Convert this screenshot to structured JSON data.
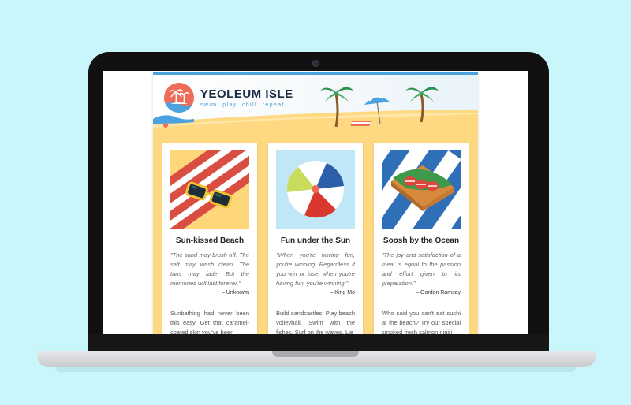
{
  "brand": {
    "name": "YEOLEUM ISLE",
    "tagline": "swim. play. chill. repeat."
  },
  "colors": {
    "background": "#c9f6fb",
    "brand_coral": "#ef6d58",
    "brand_blue": "#4aa3df",
    "sand": "#ffd981",
    "text_dark": "#1c2b44"
  },
  "cards": [
    {
      "title": "Sun-kissed Beach",
      "illustration": "sunglasses-on-towel-icon",
      "quote": "\"The sand may brush off. The salt may wash clean. The tans may fade. But the memories will last forever.\"",
      "author": "– Unknown",
      "body": "Sunbathing had never been this easy. Get that caramel-coated skin you've been"
    },
    {
      "title": "Fun under the Sun",
      "illustration": "beach-ball-icon",
      "quote": "\"When you're having fun, you're winning. Regardless if you win or lose, when you're having fun, you're winning.\"",
      "author": "– King Mo",
      "body": "Build sandcastles. Play beach volleyball. Swim with the fishes. Surf on the waves. Lie"
    },
    {
      "title": "Soosh by the Ocean",
      "illustration": "sushi-platter-icon",
      "quote": "\"The joy and satisfaction of a meal is equal to the passion and effort given to its preparation.\"",
      "author": "– Gordon Ramsay",
      "body": "Who said you can't eat sushi at the beach? Try our special smoked fresh salmon nigiri"
    }
  ]
}
